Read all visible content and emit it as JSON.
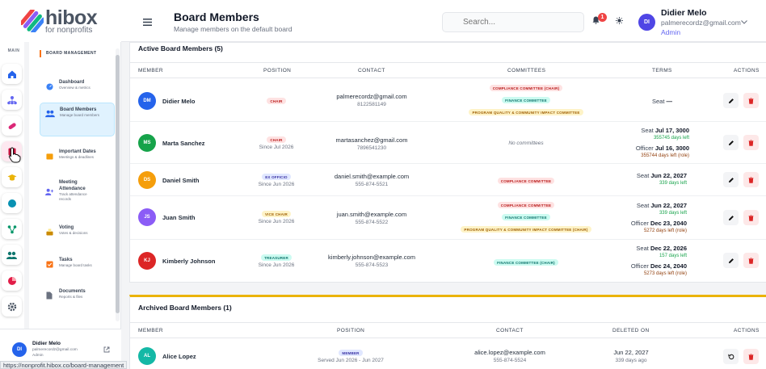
{
  "brand": {
    "name": "hibox",
    "tagline": "for nonprofits"
  },
  "sidebar": {
    "rail_label": "MAIN",
    "section_header": "BOARD MANAGEMENT",
    "items": [
      {
        "title": "Dashboard",
        "subtitle": "Overview & metrics"
      },
      {
        "title": "Board Members",
        "subtitle": "Manage board members"
      },
      {
        "title": "Important Dates",
        "subtitle": "Meetings & deadlines"
      },
      {
        "title": "Meeting Attendance",
        "subtitle": "Track attendance records"
      },
      {
        "title": "Voting",
        "subtitle": "Votes & decisions"
      },
      {
        "title": "Tasks",
        "subtitle": "Manage board tasks"
      },
      {
        "title": "Documents",
        "subtitle": "Reports & files"
      }
    ],
    "user": {
      "initials": "DI",
      "name": "Didier Melo",
      "email": "palmerecordz@gmail.com",
      "role": "Admin"
    }
  },
  "status_url": "https://nonprofit.hibox.co/board-management",
  "header": {
    "title": "Board Members",
    "subtitle": "Manage members on the default board",
    "search_placeholder": "Search...",
    "notification_count": "1",
    "user": {
      "initials": "DI",
      "name": "Didier Melo",
      "email": "palmerecordz@gmail.com",
      "role": "Admin"
    }
  },
  "active": {
    "title": "Active Board Members (5)",
    "columns": {
      "member": "MEMBER",
      "position": "POSITION",
      "contact": "CONTACT",
      "committees": "COMMITTEES",
      "terms": "TERMS",
      "actions": "ACTIONS"
    },
    "rows": [
      {
        "initials": "DM",
        "name": "Didier Melo",
        "position": "CHAIR",
        "since": "",
        "email": "palmerecordz@gmail.com",
        "phone": "8122581149",
        "committees": [
          {
            "label": "COMPLIANCE COMMITTEE (CHAIR)",
            "tone": "red"
          },
          {
            "label": "FINANCE COMMITTEE",
            "tone": "teal"
          },
          {
            "label": "PROGRAM QUALITY & COMMUNITY IMPACT COMMITTEE",
            "tone": "yel"
          }
        ],
        "terms": [
          {
            "label": "Seat",
            "value": "—",
            "note": "",
            "noteTone": ""
          }
        ]
      },
      {
        "initials": "MS",
        "name": "Marta Sanchez",
        "position": "CHAIR",
        "since": "Since Jul 2026",
        "email": "martasanchez@gmail.com",
        "phone": "7896541230",
        "committees": [],
        "no_committees": "No committees",
        "terms": [
          {
            "label": "Seat",
            "value": "Jul 17, 3000",
            "note": "355745 days left",
            "noteTone": "green"
          },
          {
            "label": "Officer",
            "value": "Jul 16, 3000",
            "note": "355744 days left (role)",
            "noteTone": "brown"
          }
        ]
      },
      {
        "initials": "DS",
        "name": "Daniel Smith",
        "position": "EX OFFICIO",
        "since": "Since Jun 2026",
        "email": "daniel.smith@example.com",
        "phone": "555-874-5521",
        "committees": [
          {
            "label": "COMPLIANCE COMMITTEE",
            "tone": "red"
          }
        ],
        "terms": [
          {
            "label": "Seat",
            "value": "Jun 22, 2027",
            "note": "339 days left",
            "noteTone": "green"
          }
        ]
      },
      {
        "initials": "JS",
        "name": "Juan Smith",
        "position": "VICE CHAIR",
        "since": "Since Jun 2026",
        "email": "juan.smith@example.com",
        "phone": "555-874-5522",
        "committees": [
          {
            "label": "COMPLIANCE COMMITTEE",
            "tone": "red"
          },
          {
            "label": "FINANCE COMMITTEE",
            "tone": "teal"
          },
          {
            "label": "PROGRAM QUALITY & COMMUNITY IMPACT COMMITTEE (CHAIR)",
            "tone": "yel"
          }
        ],
        "terms": [
          {
            "label": "Seat",
            "value": "Jun 22, 2027",
            "note": "339 days left",
            "noteTone": "green"
          },
          {
            "label": "Officer",
            "value": "Dec 23, 2040",
            "note": "5272 days left (role)",
            "noteTone": "brown"
          }
        ]
      },
      {
        "initials": "KJ",
        "name": "Kimberly Johnson",
        "position": "TREASURER",
        "since": "Since Jun 2026",
        "email": "kimberly.johnson@example.com",
        "phone": "555-874-5523",
        "committees": [
          {
            "label": "FINANCE COMMITTEE (CHAIR)",
            "tone": "teal"
          }
        ],
        "terms": [
          {
            "label": "Seat",
            "value": "Dec 22, 2026",
            "note": "157 days left",
            "noteTone": "green"
          },
          {
            "label": "Officer",
            "value": "Dec 24, 2040",
            "note": "5273 days left (role)",
            "noteTone": "brown"
          }
        ]
      }
    ]
  },
  "archived": {
    "title": "Archived Board Members (1)",
    "columns": {
      "member": "MEMBER",
      "position": "POSITION",
      "contact": "CONTACT",
      "deleted_on": "DELETED ON",
      "actions": "ACTIONS"
    },
    "rows": [
      {
        "initials": "AL",
        "name": "Alice Lopez",
        "position": "MEMBER",
        "served": "Served Jun 2026 - Jun 2027",
        "email": "alice.lopez@example.com",
        "phone": "555-874-5524",
        "deleted": "Jun 22, 2027",
        "ago": "339 days ago"
      }
    ]
  },
  "colors": {
    "accent": "#f97316",
    "archived_bar": "#eab308",
    "avatar_a": "#2563eb",
    "avatar_b": "#16a34a",
    "avatar_c": "#f59e0b",
    "avatar_d": "#8b5cf6",
    "avatar_e": "#dc2626"
  }
}
